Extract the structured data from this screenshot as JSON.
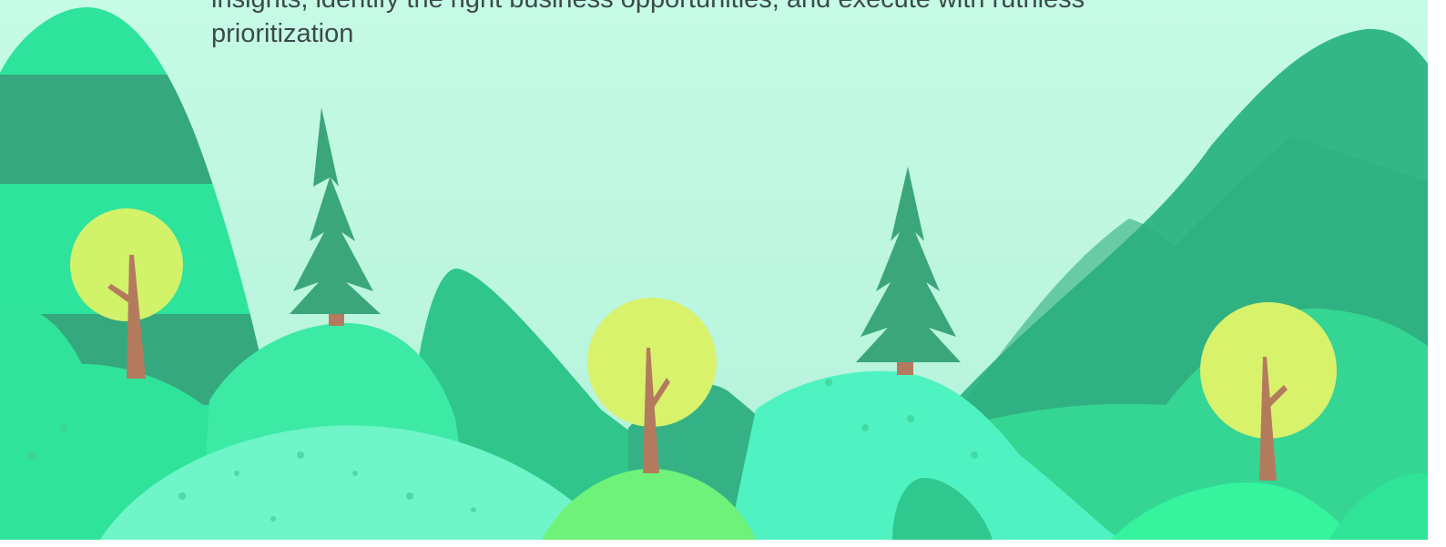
{
  "hero": {
    "tagline_line1": "insights, identify the right business opportunities, and execute with ruthless",
    "tagline_line2": "prioritization"
  },
  "illustration": {
    "subject": "forest-hills-landscape",
    "colors": {
      "sky": "#c6fbe5",
      "mountain_dark": "#33b786",
      "hill_green": "#3fe0a0",
      "hill_light": "#5ff3c0",
      "pine": "#3aa67a",
      "tree_crown": "#d8f26c",
      "trunk": "#b47a5e"
    }
  }
}
